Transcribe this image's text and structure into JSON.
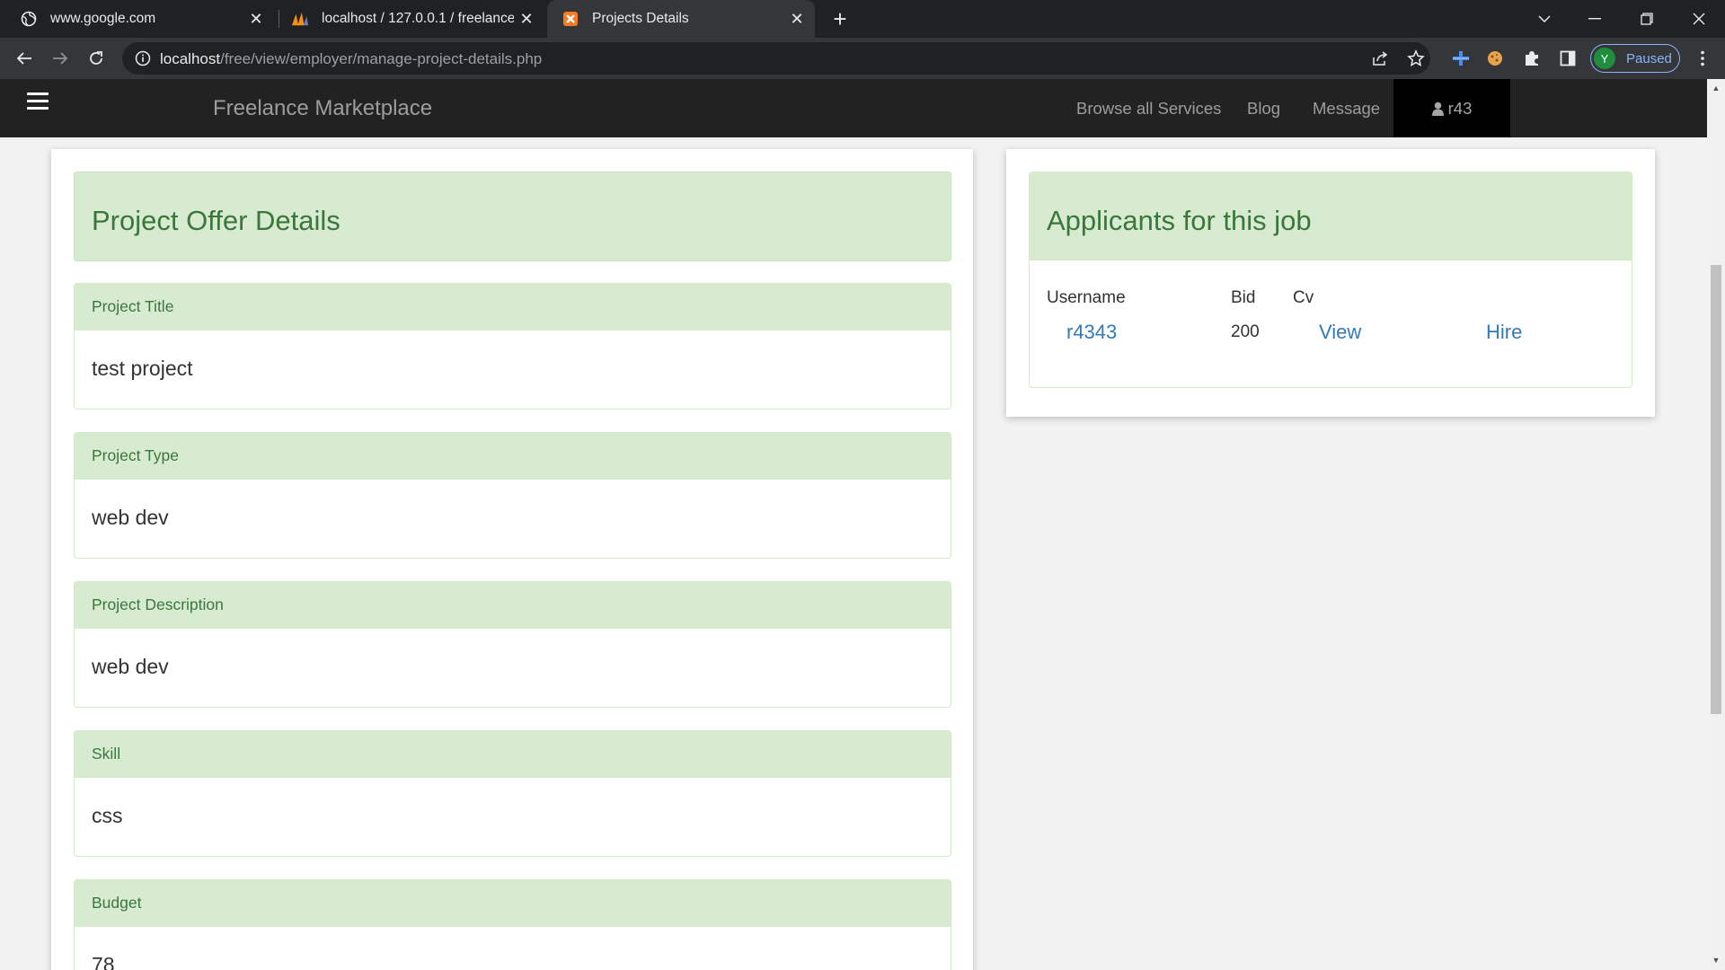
{
  "browser": {
    "tabs": [
      {
        "title": "www.google.com",
        "favicon": "globe-icon",
        "active": false
      },
      {
        "title": "localhost / 127.0.0.1 / freelance /",
        "favicon": "phpmyadmin-icon",
        "active": false
      },
      {
        "title": "Projects Details",
        "favicon": "xampp-icon",
        "active": true
      }
    ],
    "url_host": "localhost",
    "url_path": "/free/view/employer/manage-project-details.php",
    "profile_initial": "Y",
    "profile_label": "Paused",
    "colors": {
      "tabbar": "#202124",
      "toolbar": "#35363a",
      "accent": "#8ab4f8"
    }
  },
  "site": {
    "brand": "Freelance Marketplace",
    "nav_links": [
      "Browse all Services",
      "Blog",
      "Message"
    ],
    "user": "r43"
  },
  "project": {
    "heading": "Project Offer Details",
    "fields": [
      {
        "label": "Project Title",
        "value": "test project"
      },
      {
        "label": "Project Type",
        "value": "web dev"
      },
      {
        "label": "Project Description",
        "value": "web dev"
      },
      {
        "label": "Skill",
        "value": "css"
      },
      {
        "label": "Budget",
        "value": "78"
      }
    ]
  },
  "applicants": {
    "heading": "Applicants for this job",
    "columns": [
      "Username",
      "Bid",
      "Cv"
    ],
    "rows": [
      {
        "username": "r4343",
        "bid": "200",
        "cv": "View",
        "action": "Hire"
      }
    ]
  },
  "colors": {
    "panel_heading_bg": "#d6ebd0",
    "panel_heading_text": "#3c763d",
    "link": "#337ab7",
    "navbar": "#222222"
  }
}
